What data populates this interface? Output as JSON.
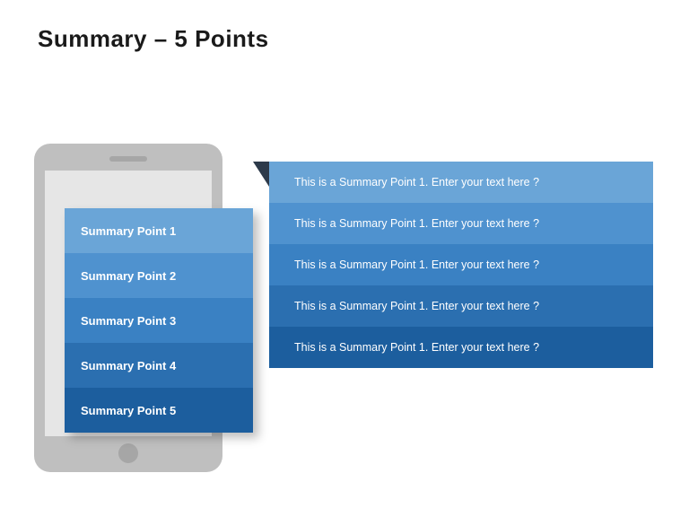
{
  "title": "Summary – 5 Points",
  "left": {
    "items": [
      {
        "label": "Summary Point 1"
      },
      {
        "label": "Summary Point 2"
      },
      {
        "label": "Summary Point 3"
      },
      {
        "label": "Summary Point 4"
      },
      {
        "label": "Summary Point 5"
      }
    ]
  },
  "right": {
    "items": [
      {
        "text": "This is a Summary Point 1. Enter your text here ?"
      },
      {
        "text": "This is a Summary Point 1. Enter your text here ?"
      },
      {
        "text": "This is a Summary Point 1. Enter your text here ?"
      },
      {
        "text": "This is a Summary Point 1. Enter your text here ?"
      },
      {
        "text": "This is a Summary Point 1. Enter your text here ?"
      }
    ]
  },
  "colors": {
    "shades": [
      "#6aa5d7",
      "#4f92cf",
      "#3a81c3",
      "#2b6fb0",
      "#1c5e9e"
    ]
  }
}
